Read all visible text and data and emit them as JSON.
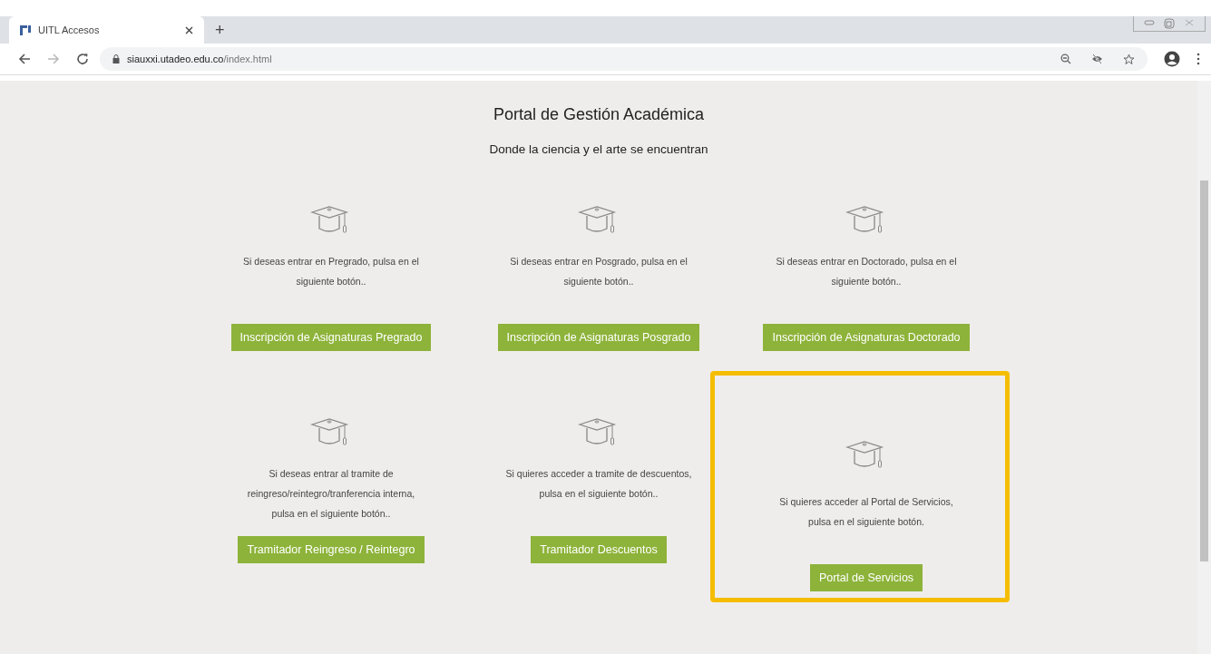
{
  "browser": {
    "tab": {
      "title": "UITL Accesos",
      "selected": true
    },
    "new_tab": "+",
    "address": {
      "domain": "siauxxi.utadeo.edu.co",
      "path": "/index.html"
    }
  },
  "page": {
    "title": "Portal de Gestión Académica",
    "subtitle": "Donde la ciencia y el arte se encuentran",
    "cards": [
      {
        "description": "Si deseas entrar en Pregrado, pulsa en el siguiente botón..",
        "button": "Inscripción de Asignaturas Pregrado",
        "highlighted": false
      },
      {
        "description": "Si deseas entrar en Posgrado, pulsa en el siguiente botón..",
        "button": "Inscripción de Asignaturas Posgrado",
        "highlighted": false
      },
      {
        "description": "Si deseas entrar en Doctorado, pulsa en el siguiente botón..",
        "button": "Inscripción de Asignaturas Doctorado",
        "highlighted": false
      },
      {
        "description": "Si deseas entrar al tramite de reingreso/reintegro/tranferencia interna, pulsa en el siguiente botón..",
        "button": "Tramitador Reingreso / Reintegro",
        "highlighted": false
      },
      {
        "description": "Si quieres acceder a tramite de descuentos, pulsa en el siguiente botón..",
        "button": "Tramitador Descuentos",
        "highlighted": false
      },
      {
        "description": "Si quieres acceder al Portal de Servicios, pulsa en el siguiente botón.",
        "button": "Portal de Servicios",
        "highlighted": true
      }
    ]
  }
}
